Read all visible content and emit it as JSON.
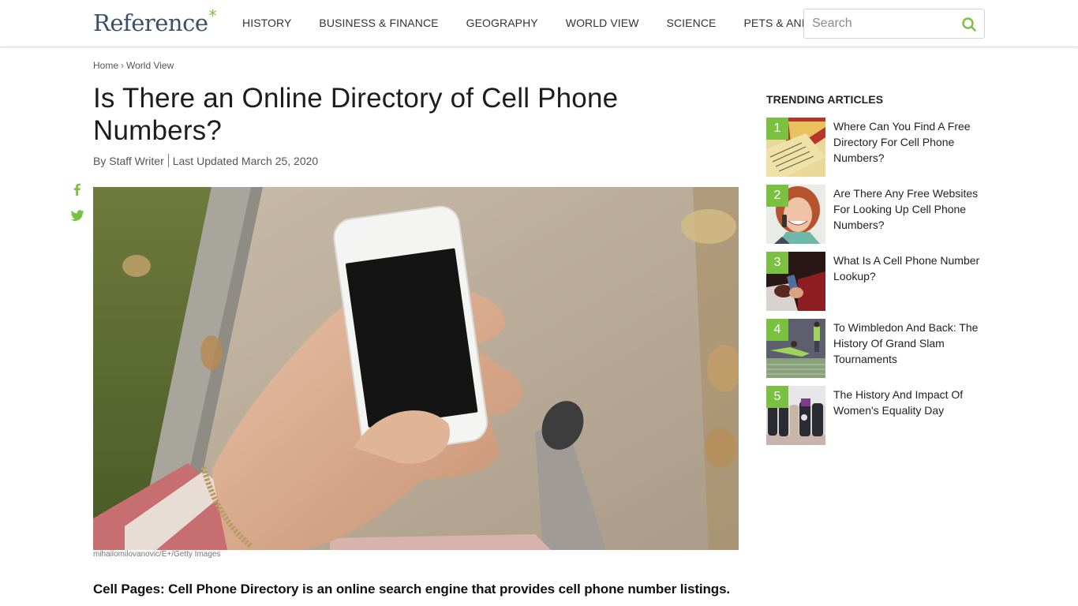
{
  "header": {
    "logo_text": "Reference",
    "logo_mark": "*",
    "nav": [
      {
        "label": "HISTORY"
      },
      {
        "label": "BUSINESS & FINANCE"
      },
      {
        "label": "GEOGRAPHY"
      },
      {
        "label": "WORLD VIEW"
      },
      {
        "label": "SCIENCE"
      },
      {
        "label": "PETS & ANIMALS"
      }
    ],
    "search": {
      "placeholder": "Search",
      "value": "",
      "icon": "search-icon"
    }
  },
  "breadcrumb": {
    "items": [
      {
        "label": "Home"
      },
      {
        "label": "World View"
      }
    ],
    "separator": "›"
  },
  "article": {
    "title": "Is There an Online Directory of Cell Phone Numbers?",
    "author": "By Staff Writer",
    "updated": "Last Updated March 25, 2020",
    "share_icons": [
      "facebook-icon",
      "twitter-icon"
    ],
    "image_alt": "Hand holding a white smartphone over a sidewalk",
    "image_credit": "mihailomilovanovic/E+/Getty Images",
    "lead": "Cell Pages: Cell Phone Directory is an online search engine that provides cell phone number listings."
  },
  "trending": {
    "heading": "TRENDING ARTICLES",
    "items": [
      {
        "rank": "1",
        "title": "Where Can You Find A Free Directory For Cell Phone Numbers?"
      },
      {
        "rank": "2",
        "title": "Are There Any Free Websites For Looking Up Cell Phone Numbers?"
      },
      {
        "rank": "3",
        "title": "What Is A Cell Phone Number Lookup?"
      },
      {
        "rank": "4",
        "title": "To Wimbledon And Back: The History Of Grand Slam Tournaments"
      },
      {
        "rank": "5",
        "title": "The History And Impact Of Women's Equality Day"
      }
    ]
  },
  "colors": {
    "accent": "#7ac142",
    "logo": "#3b5068",
    "text": "#222222"
  }
}
